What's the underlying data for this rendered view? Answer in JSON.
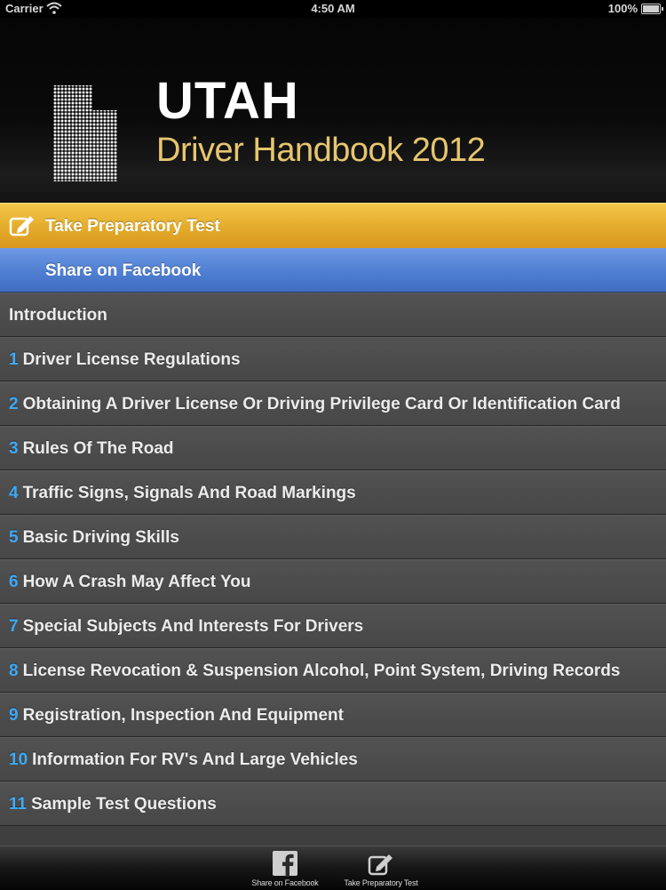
{
  "status_bar": {
    "carrier": "Carrier",
    "time": "4:50 AM",
    "battery": "100%"
  },
  "header": {
    "title": "UTAH",
    "subtitle": "Driver Handbook 2012",
    "logo_icon": "utah-state-shape-icon",
    "title_color": "#ffffff",
    "subtitle_color": "#e6c66e"
  },
  "actions": {
    "prep_test": {
      "label": "Take Preparatory Test",
      "icon": "edit-pencil-icon",
      "color": "#e5ad2d"
    },
    "facebook": {
      "label": "Share on Facebook",
      "color": "#4f7fd2"
    }
  },
  "chapters": [
    {
      "num": "",
      "title": "Introduction"
    },
    {
      "num": "1",
      "title": "Driver License Regulations"
    },
    {
      "num": "2",
      "title": "Obtaining A Driver License Or Driving Privilege Card Or Identification Card"
    },
    {
      "num": "3",
      "title": "Rules Of The Road"
    },
    {
      "num": "4",
      "title": "Traffic Signs, Signals And Road Markings"
    },
    {
      "num": "5",
      "title": "Basic Driving Skills"
    },
    {
      "num": "6",
      "title": "How A Crash May Affect You"
    },
    {
      "num": "7",
      "title": "Special Subjects And Interests For Drivers"
    },
    {
      "num": "8",
      "title": "License Revocation & Suspension Alcohol, Point System, Driving Records"
    },
    {
      "num": "9",
      "title": "Registration, Inspection And Equipment"
    },
    {
      "num": "10",
      "title": "Information For RV's And Large Vehicles"
    },
    {
      "num": "11",
      "title": "Sample Test Questions"
    }
  ],
  "tabbar": {
    "facebook": {
      "label": "Share on Facebook",
      "icon": "facebook-icon"
    },
    "prep_test": {
      "label": "Take Preparatory Test",
      "icon": "edit-pencil-icon"
    }
  },
  "colors": {
    "chapter_number": "#3fa9f5",
    "list_background": "#4b4b4b"
  }
}
